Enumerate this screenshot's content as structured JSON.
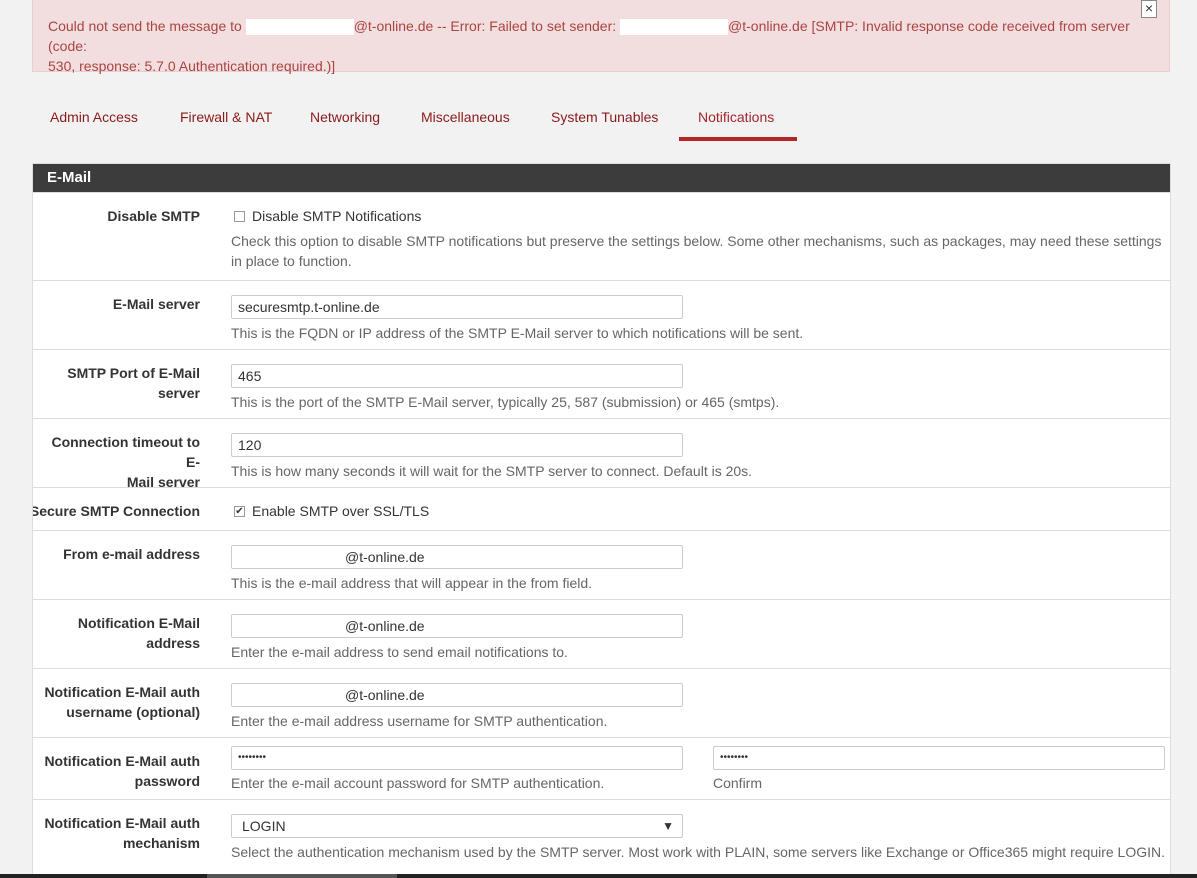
{
  "alert": {
    "prefix": "Could not send the message to",
    "addr1_suffix": "@t-online.de -- Error: Failed to set sender:",
    "addr2_suffix": "@t-online.de [SMTP: Invalid response code received from server (code:",
    "line2": "530, response: 5.7.0 Authentication required.)]",
    "close_glyph": "×"
  },
  "tabs": [
    {
      "label": "Admin Access"
    },
    {
      "label": "Firewall & NAT"
    },
    {
      "label": "Networking"
    },
    {
      "label": "Miscellaneous"
    },
    {
      "label": "System Tunables"
    },
    {
      "label": "Notifications",
      "active": true
    }
  ],
  "panel": {
    "title": "E-Mail",
    "disable_smtp": {
      "label": "Disable SMTP",
      "checkbox_label": "Disable SMTP Notifications",
      "checked": false,
      "help1": "Check this option to disable SMTP notifications but preserve the settings below. Some other mechanisms, such as packages, may need these settings",
      "help2": "in place to function."
    },
    "server": {
      "label": "E-Mail server",
      "value": "securesmtp.t-online.de",
      "help": "This is the FQDN or IP address of the SMTP E-Mail server to which notifications will be sent."
    },
    "port": {
      "label1": "SMTP Port of E-Mail",
      "label2": "server",
      "value": "465",
      "help": "This is the port of the SMTP E-Mail server, typically 25, 587 (submission) or 465 (smtps)."
    },
    "timeout": {
      "label1": "Connection timeout to E-",
      "label2": "Mail server",
      "value": "120",
      "help": "This is how many seconds it will wait for the SMTP server to connect. Default is 20s."
    },
    "secure": {
      "label": "Secure SMTP Connection",
      "checkbox_label": "Enable SMTP over SSL/TLS",
      "checked": true,
      "check_glyph": "✔"
    },
    "from": {
      "label": "From e-mail address",
      "value": "@t-online.de",
      "help": "This is the e-mail address that will appear in the from field."
    },
    "notify": {
      "label1": "Notification E-Mail",
      "label2": "address",
      "value": "@t-online.de",
      "help": "Enter the e-mail address to send email notifications to."
    },
    "username": {
      "label1": "Notification E-Mail auth",
      "label2": "username (optional)",
      "value": "@t-online.de",
      "help": "Enter the e-mail address username for SMTP authentication."
    },
    "password": {
      "label1": "Notification E-Mail auth",
      "label2": "password",
      "value": "••••••••",
      "confirm_value": "••••••••",
      "help": "Enter the e-mail account password for SMTP authentication.",
      "confirm_help": "Confirm"
    },
    "mechanism": {
      "label1": "Notification E-Mail auth",
      "label2": "mechanism",
      "value": "LOGIN",
      "arrow_glyph": "▼",
      "help": "Select the authentication mechanism used by the SMTP server. Most work with PLAIN, some servers like Exchange or Office365 might require LOGIN."
    }
  }
}
